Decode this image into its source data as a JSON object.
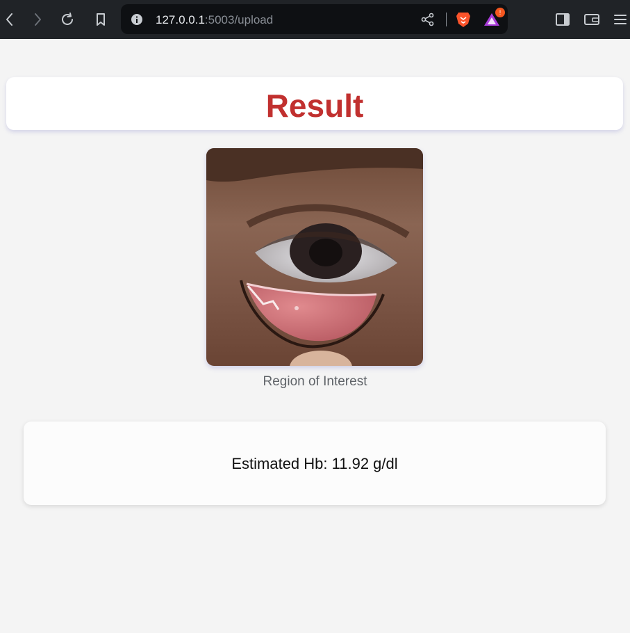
{
  "browser": {
    "url_host": "127.0.0.1",
    "url_rest": ":5003/upload",
    "icons": [
      "back-icon",
      "forward-icon",
      "reload-icon",
      "bookmark-icon",
      "info-icon",
      "share-icon",
      "brave-lion-icon",
      "brave-rewards-icon",
      "sidebar-icon",
      "wallet-icon",
      "menu-icon"
    ],
    "rewards_badge": "!"
  },
  "page": {
    "title": "Result",
    "image_caption": "Region of Interest",
    "estimate_label": "Estimated Hb:",
    "estimate_value": "11.92 g/dl"
  },
  "colors": {
    "title": "#c1302f",
    "background": "#f4f4f4",
    "toolbar": "#202327"
  }
}
